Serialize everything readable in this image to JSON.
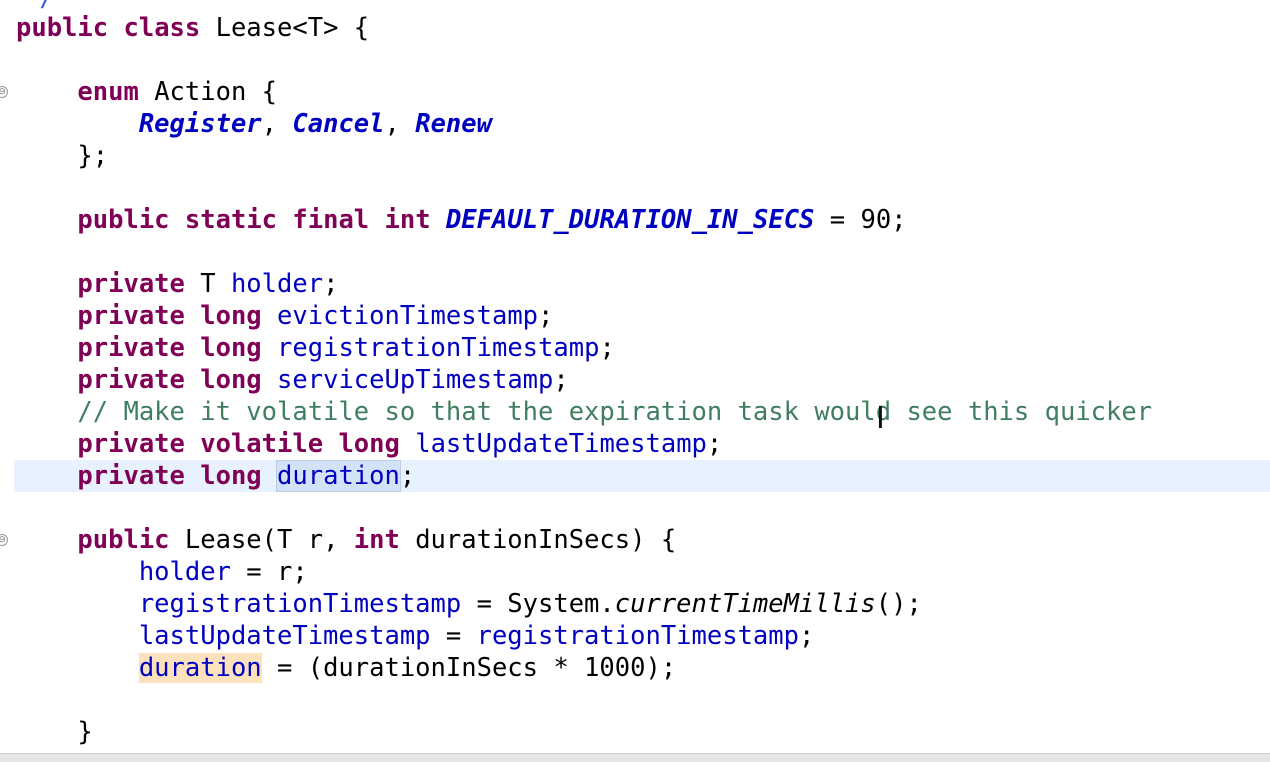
{
  "editor": {
    "accent_colors": {
      "keyword": "#7f0055",
      "field": "#0000c0",
      "comment": "#3f7f5f",
      "current_line": "#e8f2fe",
      "read_occurrence": "#d4e2f7",
      "write_occurrence": "#fbe2bd"
    },
    "top_comment": "*/",
    "fold_marker": "⊖",
    "code": {
      "l1": {
        "kw_public": "public",
        "kw_class": "class",
        "rest": " Lease<T> {"
      },
      "l3": {
        "kw_enum": "enum",
        "rest": " Action {"
      },
      "l4": {
        "c1": "Register",
        "sep1": ", ",
        "c2": "Cancel",
        "sep2": ", ",
        "c3": "Renew"
      },
      "l5": {
        "text": "};"
      },
      "l7": {
        "kw_public": "public",
        "kw_static": "static",
        "kw_final": "final",
        "kw_int": "int",
        "const": "DEFAULT_DURATION_IN_SECS",
        "rest": " = 90;"
      },
      "l9": {
        "kw_private": "private",
        "type": " T ",
        "field": "holder",
        "semi": ";"
      },
      "l10": {
        "kw_private": "private",
        "kw_long": "long",
        "field": "evictionTimestamp",
        "semi": ";"
      },
      "l11": {
        "kw_private": "private",
        "kw_long": "long",
        "field": "registrationTimestamp",
        "semi": ";"
      },
      "l12": {
        "kw_private": "private",
        "kw_long": "long",
        "field": "serviceUpTimestamp",
        "semi": ";"
      },
      "l13": {
        "comment": "// Make it volatile so that the expiration task would see this quicker"
      },
      "l14": {
        "kw_private": "private",
        "kw_volatile": "volatile",
        "kw_long": "long",
        "field": "lastUpdateTimestamp",
        "semi": ";"
      },
      "l15": {
        "kw_private": "private",
        "kw_long": "long",
        "field": "duration",
        "semi": ";"
      },
      "l17": {
        "kw_public": "public",
        "ctor": " Lease(T r, ",
        "kw_int": "int",
        "rest": " durationInSecs) {"
      },
      "l18": {
        "field": "holder",
        "rest": " = r;"
      },
      "l19": {
        "field": "registrationTimestamp",
        "mid": " = System.",
        "static_call": "currentTimeMillis",
        "rest": "();"
      },
      "l20": {
        "field1": "lastUpdateTimestamp",
        "mid": " = ",
        "field2": "registrationTimestamp",
        "semi": ";"
      },
      "l21": {
        "field": "duration",
        "rest": " = (durationInSecs * 1000);"
      },
      "l23": {
        "text": "}"
      }
    }
  }
}
